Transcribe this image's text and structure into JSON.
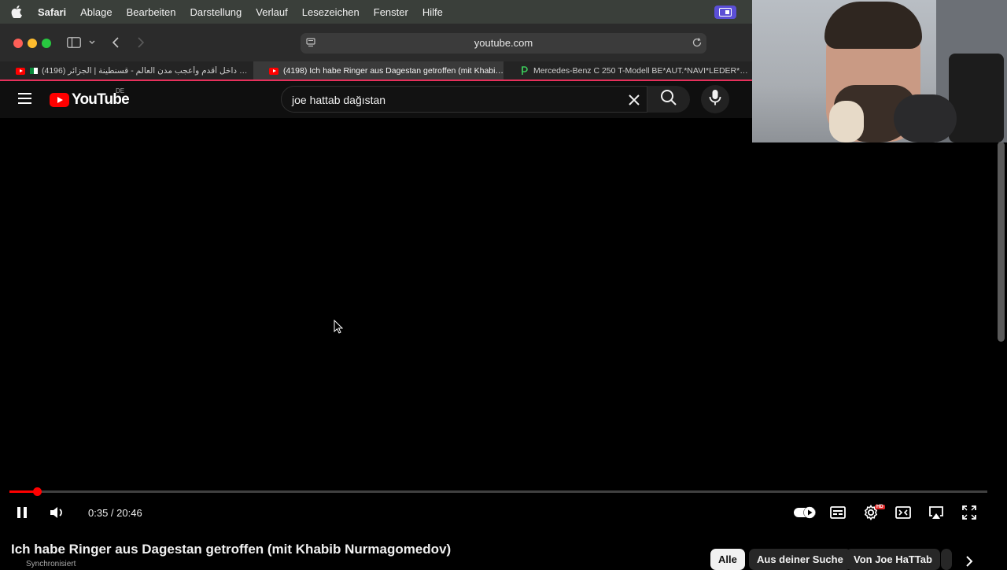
{
  "menubar": {
    "app_name": "Safari",
    "items": [
      "Ablage",
      "Bearbeiten",
      "Darstellung",
      "Verlauf",
      "Lesezeichen",
      "Fenster",
      "Hilfe"
    ]
  },
  "browser": {
    "url": "youtube.com",
    "tabs": [
      {
        "label": "(4196) داخل أقدم وأعجب مدن العالم - قسنطينة | الجزائر Const...",
        "favicon": "youtube-icon",
        "active": false
      },
      {
        "label": "(4198) Ich habe Ringer aus Dagestan getroffen (mit Khabib...",
        "favicon": "youtube-icon",
        "active": true
      },
      {
        "label": "Mercedes-Benz C 250 T-Modell BE*AUT.*NAVI*LEDER*XEN...",
        "favicon": "mobile-de-icon",
        "active": false
      }
    ]
  },
  "youtube": {
    "logo_text": "YouTube",
    "region": "DE",
    "search_value": "joe hattab dağıstan"
  },
  "player": {
    "current_time": "0:35",
    "duration": "20:46",
    "time_display": "0:35 / 20:46",
    "progress_fraction": 0.028,
    "hd_badge": "HD"
  },
  "video": {
    "title": "Ich habe Ringer aus Dagestan getroffen (mit Khabib Nurmagomedov)",
    "sync_label": "Synchronisiert"
  },
  "chips": [
    "Alle",
    "Aus deiner Suche",
    "Von Joe HaTTab"
  ],
  "colors": {
    "youtube_red": "#ff0000",
    "active_tab_accent": "#e6305b",
    "background": "#0f0f0f"
  }
}
